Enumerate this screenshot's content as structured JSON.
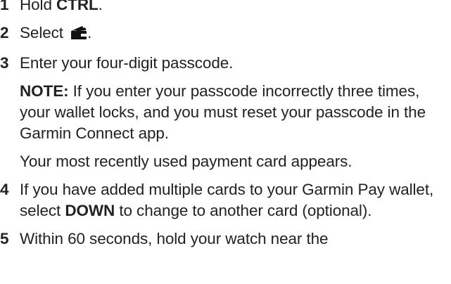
{
  "steps": [
    {
      "num": "1",
      "pre": "Hold ",
      "bold": "CTRL",
      "post": "."
    },
    {
      "num": "2",
      "pre": "Select ",
      "icon": "wallet-icon",
      "post": "."
    },
    {
      "num": "3",
      "text": "Enter your four-digit passcode.",
      "note_label": "NOTE:",
      "note_text": " If you enter your passcode incorrectly three times, your wallet locks, and you must reset your passcode in the Garmin Connect app.",
      "result": "Your most recently used payment card appears."
    },
    {
      "num": "4",
      "pre": "If you have added multiple cards to your Garmin Pay wallet, select ",
      "bold": "DOWN",
      "post": " to change to another card (optional)."
    },
    {
      "num": "5",
      "text": "Within 60 seconds, hold your watch near the"
    }
  ]
}
